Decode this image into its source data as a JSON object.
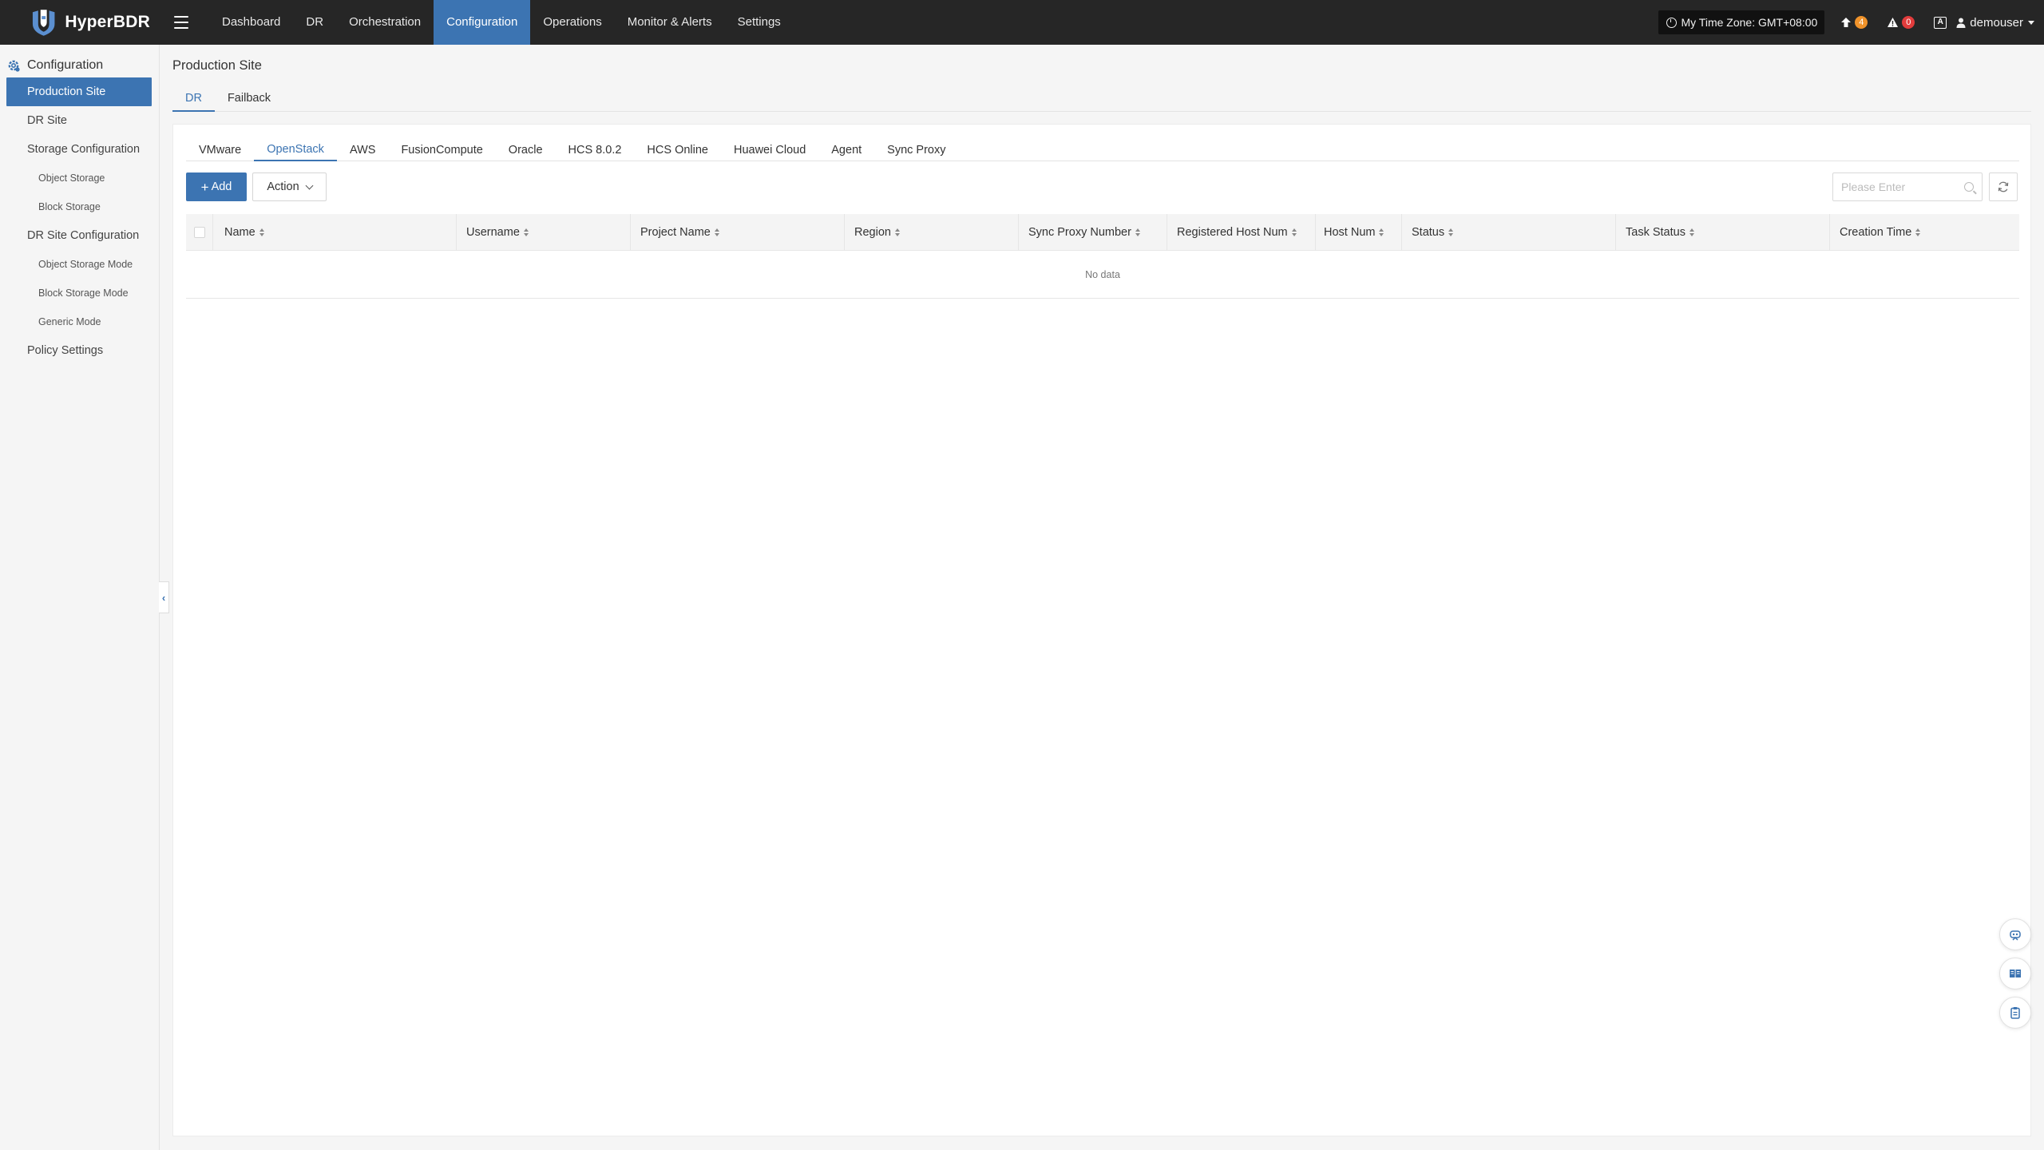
{
  "brand": {
    "name": "HyperBDR"
  },
  "topnav": {
    "items": [
      {
        "label": "Dashboard"
      },
      {
        "label": "DR"
      },
      {
        "label": "Orchestration"
      },
      {
        "label": "Configuration"
      },
      {
        "label": "Operations"
      },
      {
        "label": "Monitor & Alerts"
      },
      {
        "label": "Settings"
      }
    ],
    "active_index": 3
  },
  "header_right": {
    "timezone": "My Time Zone: GMT+08:00",
    "upload_count": "4",
    "alert_count": "0",
    "language_glyph": "A",
    "username": "demouser"
  },
  "sidebar": {
    "title": "Configuration",
    "items": [
      {
        "label": "Production Site"
      },
      {
        "label": "DR Site"
      },
      {
        "label": "Storage Configuration"
      },
      {
        "label": "Object Storage"
      },
      {
        "label": "Block Storage"
      },
      {
        "label": "DR Site Configuration"
      },
      {
        "label": "Object Storage Mode"
      },
      {
        "label": "Block Storage Mode"
      },
      {
        "label": "Generic Mode"
      },
      {
        "label": "Policy Settings"
      }
    ]
  },
  "main": {
    "page_title": "Production Site",
    "subtabs": [
      {
        "label": "DR"
      },
      {
        "label": "Failback"
      }
    ],
    "platform_tabs": [
      {
        "label": "VMware"
      },
      {
        "label": "OpenStack"
      },
      {
        "label": "AWS"
      },
      {
        "label": "FusionCompute"
      },
      {
        "label": "Oracle"
      },
      {
        "label": "HCS 8.0.2"
      },
      {
        "label": "HCS Online"
      },
      {
        "label": "Huawei Cloud"
      },
      {
        "label": "Agent"
      },
      {
        "label": "Sync Proxy"
      }
    ],
    "add_label": "Add",
    "action_label": "Action",
    "search": {
      "placeholder": "Please Enter",
      "value": ""
    },
    "table": {
      "columns": [
        {
          "label": "Name"
        },
        {
          "label": "Username"
        },
        {
          "label": "Project Name"
        },
        {
          "label": "Region"
        },
        {
          "label": "Sync Proxy Number"
        },
        {
          "label": "Registered Host Num"
        },
        {
          "label": "Host Num"
        },
        {
          "label": "Status"
        },
        {
          "label": "Task Status"
        },
        {
          "label": "Creation Time"
        }
      ],
      "empty_text": "No data"
    }
  },
  "colors": {
    "accent": "#3c74b2",
    "topbar": "#262626",
    "badge_orange": "#f0932b",
    "badge_red": "#e23c3c"
  },
  "icons": [
    "hyperbdr-shield-icon",
    "hamburger-icon",
    "clock-icon",
    "upload-icon",
    "alert-icon",
    "language-icon",
    "user-icon",
    "gear-icon",
    "plus-icon",
    "chevron-down-icon",
    "search-icon",
    "refresh-icon",
    "collapse-left-icon",
    "robot-icon",
    "book-icon",
    "clipboard-icon"
  ]
}
